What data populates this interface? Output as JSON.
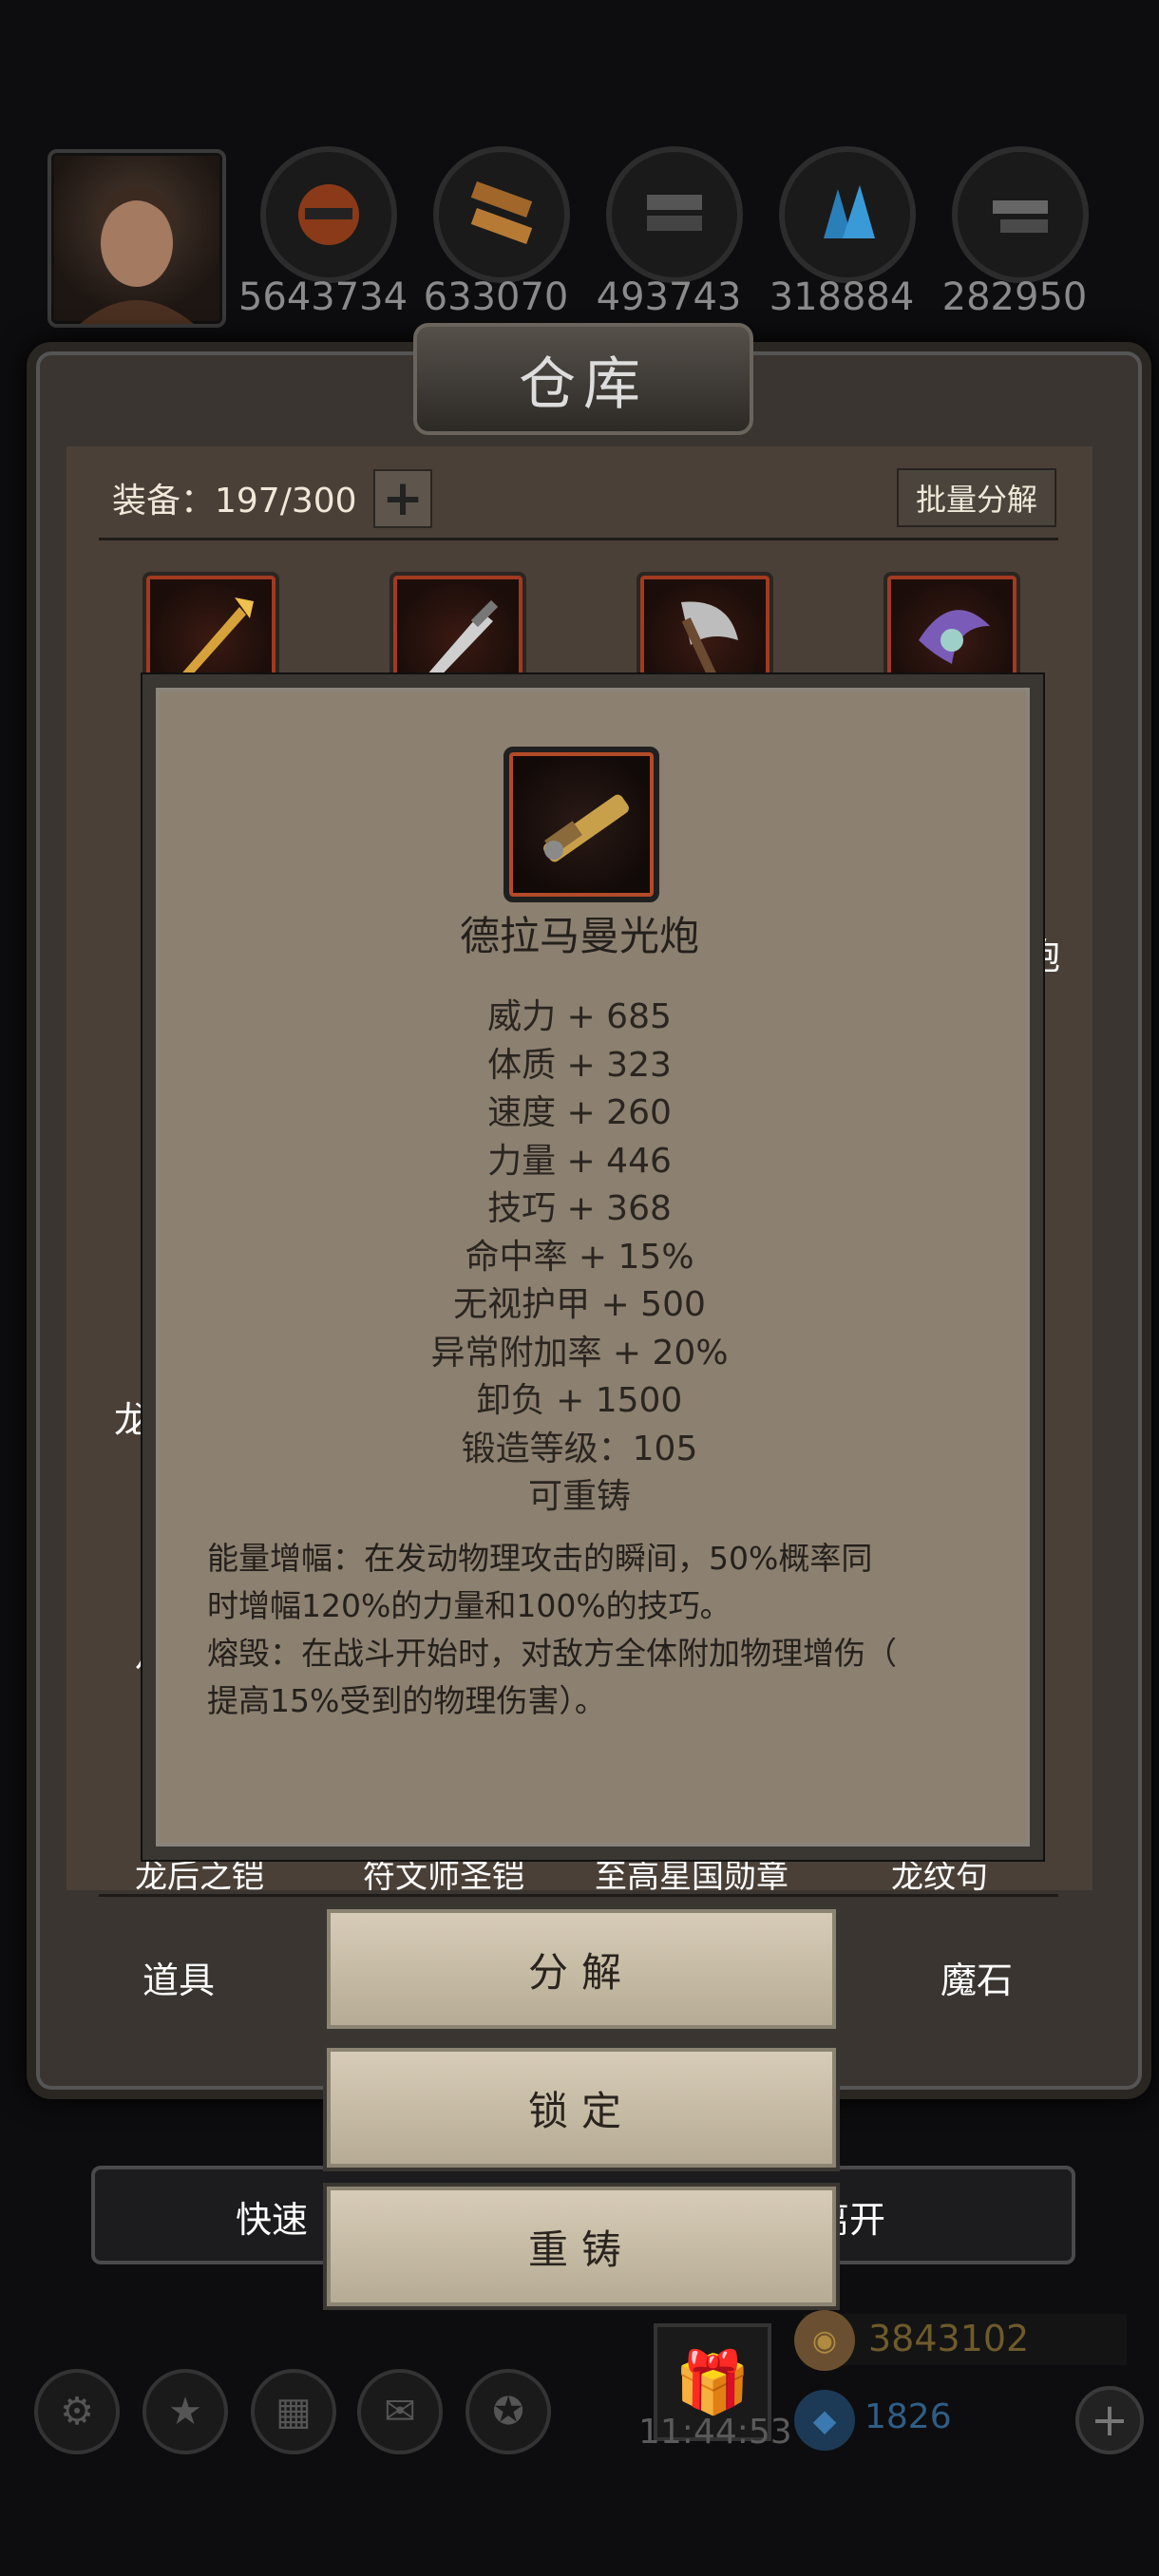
{
  "resources": [
    {
      "icon": "character-portrait",
      "value": ""
    },
    {
      "icon": "meat-icon",
      "value": "5643734"
    },
    {
      "icon": "wood-icon",
      "value": "633070"
    },
    {
      "icon": "iron-icon",
      "value": "493743"
    },
    {
      "icon": "crystal-icon",
      "value": "318884"
    },
    {
      "icon": "steel-icon",
      "value": "282950"
    }
  ],
  "warehouse": {
    "title": "仓库",
    "equip_count_label": "装备：197/300",
    "add_label": "+",
    "batch_decompose": "批量分解",
    "clipped_right_text": "炮",
    "clipped_left_text_1": "龙",
    "clipped_left_text_2": "月",
    "bottom_item_names": [
      "龙后之铠",
      "符文师圣铠",
      "至高星国勋章",
      "龙纹句"
    ],
    "tabs": {
      "left": "道具",
      "right": "魔石"
    }
  },
  "item": {
    "name": "德拉马曼光炮",
    "stats": [
      "威力 + 685",
      "体质 + 323",
      "速度 + 260",
      "力量 + 446",
      "技巧 + 368",
      "命中率 + 15%",
      "无视护甲 + 500",
      "异常附加率 + 20%",
      "卸负 + 1500",
      "锻造等级：105",
      "可重铸"
    ],
    "description": [
      "能量增幅：在发动物理攻击的瞬间，50%概率同",
      "时增幅120%的力量和100%的技巧。",
      "熔毁：在战斗开始时，对敌方全体附加物理增伤（",
      "提高15%受到的物理伤害）。"
    ]
  },
  "actions": {
    "decompose": "分解",
    "lock": "锁定",
    "reforge": "重铸"
  },
  "quickbar": {
    "left": "快速",
    "right": "离开"
  },
  "footer": {
    "timer": "11:44:53",
    "gold": "3843102",
    "gems": "1826"
  }
}
